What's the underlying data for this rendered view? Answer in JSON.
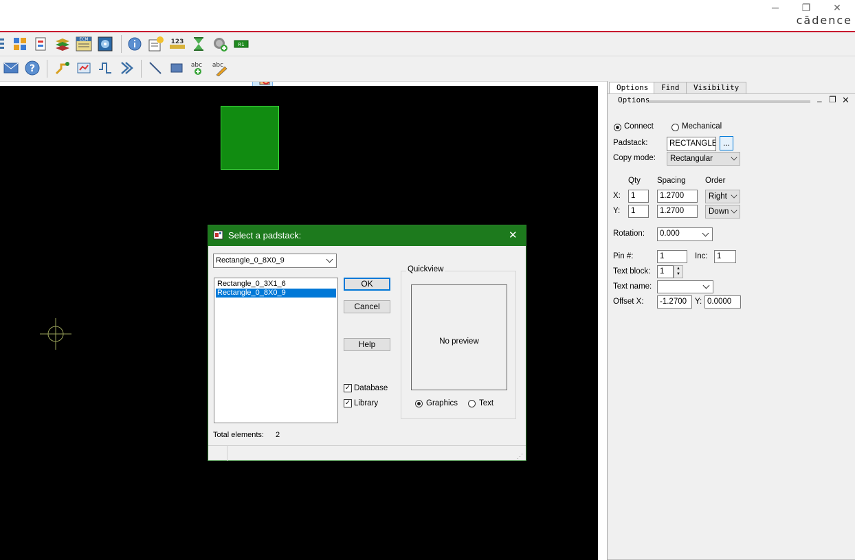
{
  "window": {
    "brand": "cādence",
    "minimize_glyph": "─",
    "restore_glyph": "❐",
    "close_glyph": "✕"
  },
  "toolbar1": {
    "icons": [
      "layers-icon",
      "grid-icon",
      "forms-icon",
      "stack-icon",
      "ecm-icon",
      "photo-icon",
      "info-icon",
      "properties-icon",
      "number-icon",
      "hourglass-icon",
      "globe-add-icon",
      "r1-icon",
      "padstack-place-icon"
    ],
    "number_label": "123",
    "r1_label": "R1",
    "ecm_label": "ECM"
  },
  "toolbar2": {
    "icons": [
      "mail-icon",
      "help-icon",
      "route-icon",
      "add-connect-icon",
      "slide-icon",
      "chevron-icon",
      "line-icon",
      "rectangle-icon",
      "text-add-icon",
      "text-edit-icon"
    ]
  },
  "panel": {
    "tabs": [
      "Options",
      "Find",
      "Visibility"
    ],
    "header": "Options",
    "connect_label": "Connect",
    "mechanical_label": "Mechanical",
    "padstack_label": "Padstack:",
    "padstack_value": "RECTANGLE",
    "browse_label": "...",
    "copy_mode_label": "Copy mode:",
    "copy_mode_value": "Rectangular",
    "qty_header": "Qty",
    "spacing_header": "Spacing",
    "order_header": "Order",
    "x_label": "X:",
    "y_label": "Y:",
    "x_qty": "1",
    "y_qty": "1",
    "x_spacing": "1.2700",
    "y_spacing": "1.2700",
    "x_order": "Right",
    "y_order": "Down",
    "rotation_label": "Rotation:",
    "rotation_value": "0.000",
    "pin_label": "Pin #:",
    "pin_value": "1",
    "inc_label": "Inc:",
    "inc_value": "1",
    "text_block_label": "Text block:",
    "text_block_value": "1",
    "text_name_label": "Text name:",
    "text_name_value": "",
    "offset_x_label": "Offset X:",
    "offset_x_value": "-1.2700",
    "offset_y_label": "Y:",
    "offset_y_value": "0.0000"
  },
  "dialog": {
    "title": "Select a padstack:",
    "dropdown_value": "Rectangle_0_8X0_9",
    "list_items": [
      "Rectangle_0_3X1_6",
      "Rectangle_0_8X0_9"
    ],
    "ok_label": "OK",
    "cancel_label": "Cancel",
    "help_label": "Help",
    "database_label": "Database",
    "library_label": "Library",
    "quickview_label": "Quickview",
    "no_preview": "No preview",
    "graphics_label": "Graphics",
    "text_label": "Text",
    "total_label": "Total elements:",
    "total_value": "2"
  },
  "colors": {
    "accent_red": "#c8102e",
    "dialog_title": "#1d7a1d",
    "pad_fill": "#118c11",
    "selection": "#0078d7"
  }
}
